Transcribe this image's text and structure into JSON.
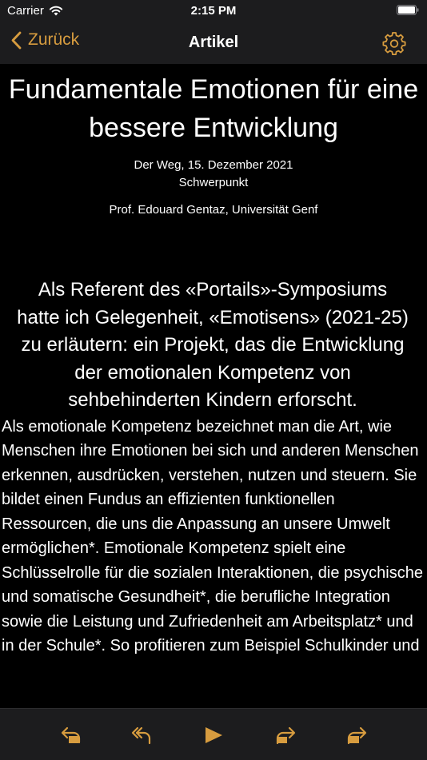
{
  "status_bar": {
    "carrier": "Carrier",
    "time": "2:15 PM"
  },
  "nav": {
    "back_label": "Zurück",
    "title": "Artikel"
  },
  "article": {
    "title": "Fundamentale Emotionen für eine bessere Entwicklung",
    "source_date": "Der Weg, 15. Dezember 2021",
    "section": "Schwerpunkt",
    "author": "Prof. Edouard Gentaz, Universität Genf",
    "lead": "Als Referent des «Portails»-Symposiums hatte ich Gelegenheit, «Emoti­sens» (2021-25) zu erläutern: ein Projekt, das die Entwicklung der emotionalen Kompetenz von sehbehinderten Kindern erforscht.",
    "body": "Als emotionale Kompetenz bezeichnet man die Art, wie Menschen ihre Emotionen bei sich und anderen Menschen erkennen, ausdrücken, verstehen, nutzen und steuern. Sie bildet einen Fundus an effizienten funktionellen Ressourcen, die uns die Anpassung an unsere Umwelt ermöglichen*. Emotionale Kompetenz spielt eine Schlüsselrolle für die sozialen Interaktionen, die psychische und somatische Gesundheit*, die berufliche Integration sowie die Leistung und Zufriedenheit am Arbeitsplatz* und in der Schule*. So profitieren zum Beispiel Schulkinder und"
  },
  "icons": {
    "accent_color": "#d79c3f",
    "toolbar": [
      "rewind-paragraph-icon",
      "back-sentence-icon",
      "play-icon",
      "forward-sentence-icon",
      "skip-paragraph-icon"
    ]
  }
}
